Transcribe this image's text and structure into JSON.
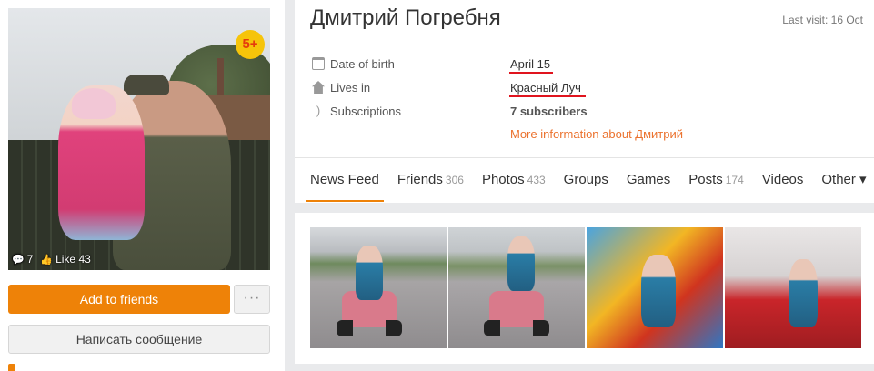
{
  "profile": {
    "name": "Дмитрий Погребня",
    "last_visit": "Last visit: 16 Oct",
    "age_badge": "5+",
    "comments_count": "7",
    "likes_label": "Like 43",
    "date_of_birth_label": "Date of birth",
    "date_of_birth_value": "April 15",
    "lives_in_label": "Lives in",
    "lives_in_value": "Красный Луч",
    "subscriptions_label": "Subscriptions",
    "subscriptions_value": "7 subscribers",
    "more_info_link": "More information about Дмитрий",
    "accent_color": "#ee8208",
    "link_color": "#eb722e",
    "underline_color": "#e0141e"
  },
  "actions": {
    "add_friends": "Add to friends",
    "more": "···",
    "send_message": "Написать сообщение"
  },
  "tabs": [
    {
      "label": "News Feed",
      "count": ""
    },
    {
      "label": "Friends",
      "count": "306"
    },
    {
      "label": "Photos",
      "count": "433"
    },
    {
      "label": "Groups",
      "count": ""
    },
    {
      "label": "Games",
      "count": ""
    },
    {
      "label": "Posts",
      "count": "174"
    },
    {
      "label": "Videos",
      "count": ""
    },
    {
      "label": "Other ▾",
      "count": ""
    }
  ],
  "icons": {
    "calendar": "calendar-icon",
    "house": "house-icon",
    "rss": "rss-icon",
    "comment": "comment-icon",
    "like": "thumbs-up-icon"
  }
}
